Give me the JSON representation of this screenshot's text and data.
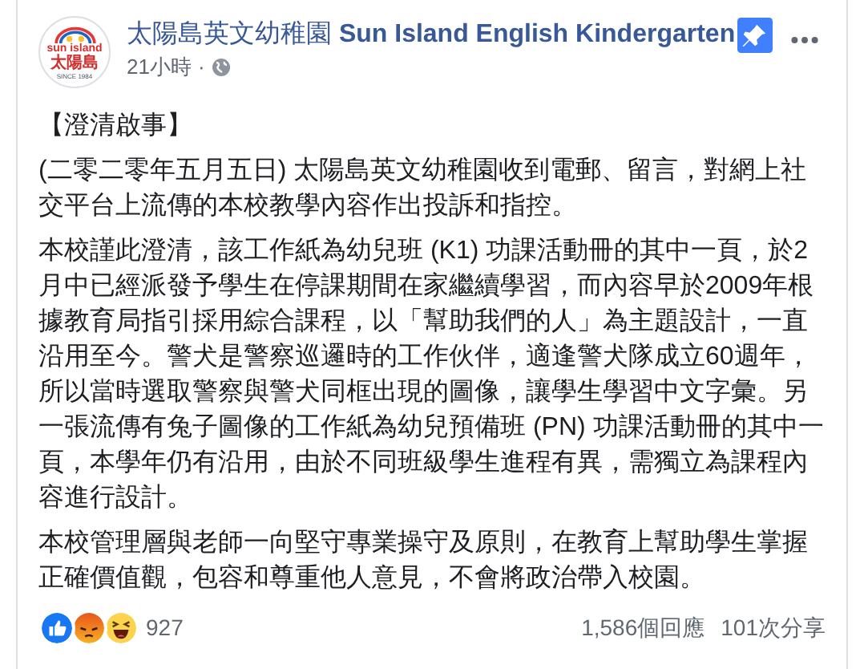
{
  "page": {
    "logo": {
      "name": "sun island",
      "chinese": "太陽島",
      "since": "SINCE 1984"
    },
    "name_chinese": "太陽島英文幼稚園",
    "name_english": "Sun Island English Kindergarten",
    "pinned": true,
    "time": "21小時",
    "separator": "·"
  },
  "post": {
    "heading": "【澄清啟事】",
    "paragraphs": [
      "(二零二零年五月五日) 太陽島英文幼稚園收到電郵、留言，對網上社交平台上流傳的本校教學內容作出投訴和指控。",
      "本校謹此澄清，該工作紙為幼兒班 (K1) 功課活動冊的其中一頁，於2月中已經派發予學生在停課期間在家繼續學習，而內容早於2009年根據教育局指引採用綜合課程，以「幫助我們的人」為主題設計，一直沿用至今。警犬是警察巡邏時的工作伙伴，適逢警犬隊成立60週年，所以當時選取警察與警犬同框出現的圖像，讓學生學習中文字彙。另一張流傳有兔子圖像的工作紙為幼兒預備班 (PN) 功課活動冊的其中一頁，本學年仍有沿用，由於不同班級學生進程有異，需獨立為課程內容進行設計。",
      "本校管理層與老師一向堅守專業操守及原則，在教育上幫助學生掌握正確價值觀，包容和尊重他人意見，不會將政治帶入校園。"
    ]
  },
  "footer": {
    "reactions": [
      {
        "kind": "like"
      },
      {
        "kind": "angry"
      },
      {
        "kind": "haha"
      }
    ],
    "reaction_count": "927",
    "comments": "1,586個回應",
    "shares": "101次分享"
  }
}
